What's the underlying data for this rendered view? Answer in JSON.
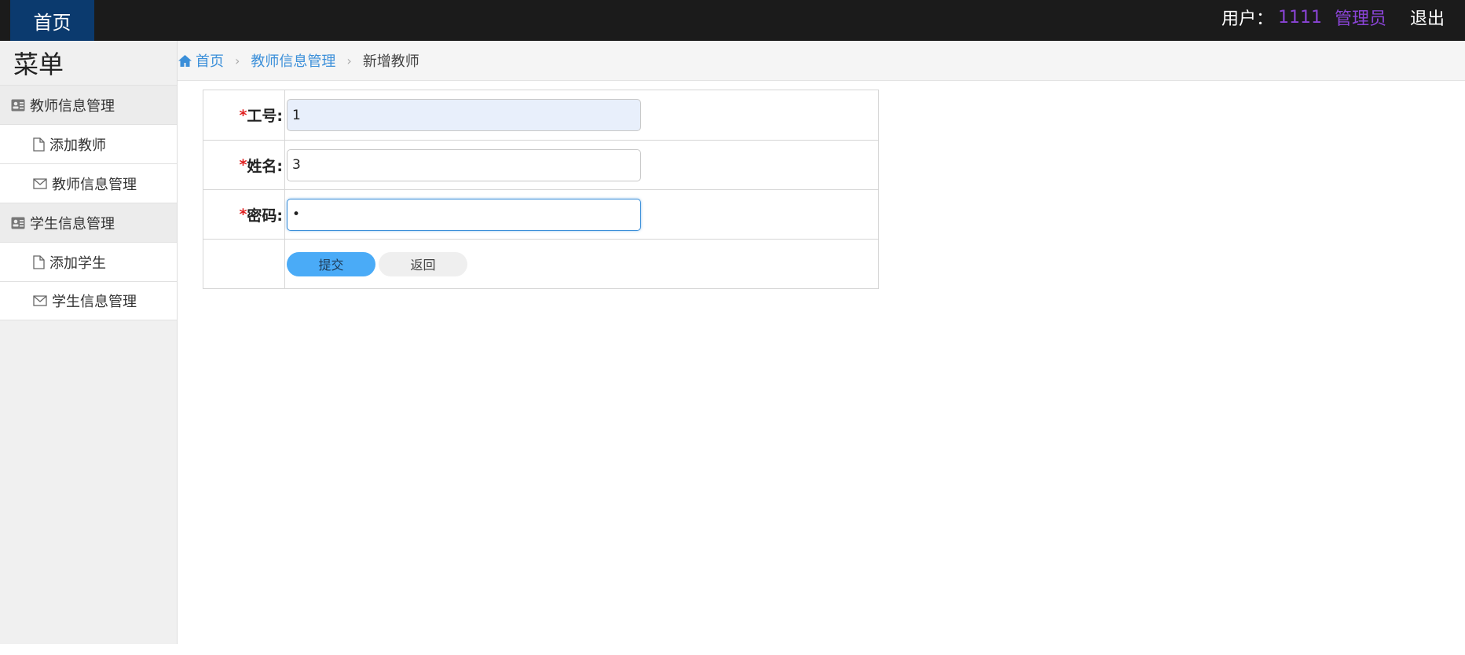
{
  "topbar": {
    "home_tab": "首页",
    "user_label": "用户：",
    "user_id": "1111",
    "user_role": "管理员",
    "logout": "退出"
  },
  "sidebar": {
    "title": "菜单",
    "groups": [
      {
        "label": "教师信息管理",
        "icon": "id-card-icon",
        "items": [
          {
            "label": "添加教师",
            "icon": "file-icon"
          },
          {
            "label": "教师信息管理",
            "icon": "envelope-icon"
          }
        ]
      },
      {
        "label": "学生信息管理",
        "icon": "id-card-icon",
        "items": [
          {
            "label": "添加学生",
            "icon": "file-icon"
          },
          {
            "label": "学生信息管理",
            "icon": "envelope-icon"
          }
        ]
      }
    ]
  },
  "breadcrumb": {
    "home": "首页",
    "section": "教师信息管理",
    "current": "新增教师"
  },
  "form": {
    "required_mark": "*",
    "fields": [
      {
        "label": "工号:",
        "value": "1"
      },
      {
        "label": "姓名:",
        "value": "3"
      },
      {
        "label": "密码:",
        "value": "•"
      }
    ],
    "submit_label": "提交",
    "back_label": "返回"
  },
  "colors": {
    "topbar_bg": "#1b1b1b",
    "home_tab_bg": "#0b3a6e",
    "user_accent": "#8a44d6",
    "link": "#3b8fd9",
    "required": "#e02020",
    "submit_bg": "#4aabf7"
  }
}
